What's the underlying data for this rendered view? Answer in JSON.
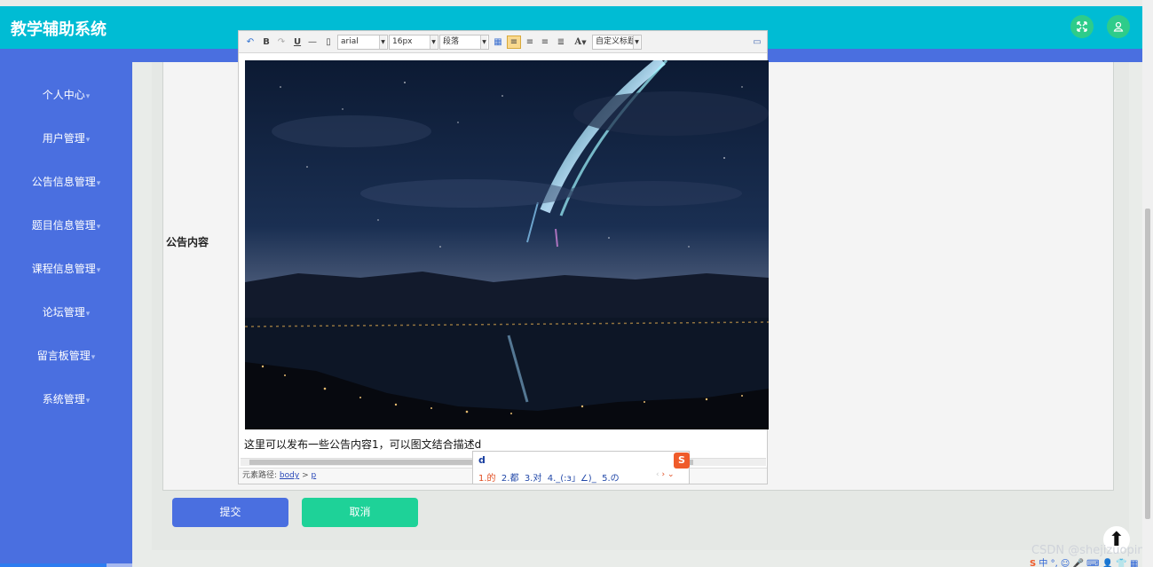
{
  "app": {
    "title": "教学辅助系统"
  },
  "header": {
    "fullscreen_icon": "expand-arrows-icon",
    "user_icon": "user-icon"
  },
  "sidebar": {
    "items": [
      {
        "label": "个人中心"
      },
      {
        "label": "用户管理"
      },
      {
        "label": "公告信息管理"
      },
      {
        "label": "题目信息管理"
      },
      {
        "label": "课程信息管理"
      },
      {
        "label": "论坛管理"
      },
      {
        "label": "留言板管理"
      },
      {
        "label": "系统管理"
      }
    ]
  },
  "form": {
    "field_label": "公告内容",
    "submit_label": "提交",
    "cancel_label": "取消"
  },
  "editor": {
    "toolbar": {
      "font_family": "arial",
      "font_size": "16px",
      "paragraph": "段落",
      "custom_heading": "自定义标题",
      "bold": "B",
      "underline": "U",
      "font_color": "A"
    },
    "content_text": "这里可以发布一些公告内容1，可以图文结合描述d",
    "status_path_label": "元素路径:",
    "status_path_body": "body",
    "status_path_sep": ">",
    "status_path_p": "p"
  },
  "ime": {
    "input": "d",
    "candidates": [
      "1.的",
      "2.都",
      "3.对",
      "4._(:з」∠)_",
      "5.の"
    ],
    "logo": "S"
  },
  "watermark": "CSDN @shejizuopin",
  "tray": {
    "items": "中 °, ☺ 🎤 ⌨ 👤 👕 ▦"
  }
}
